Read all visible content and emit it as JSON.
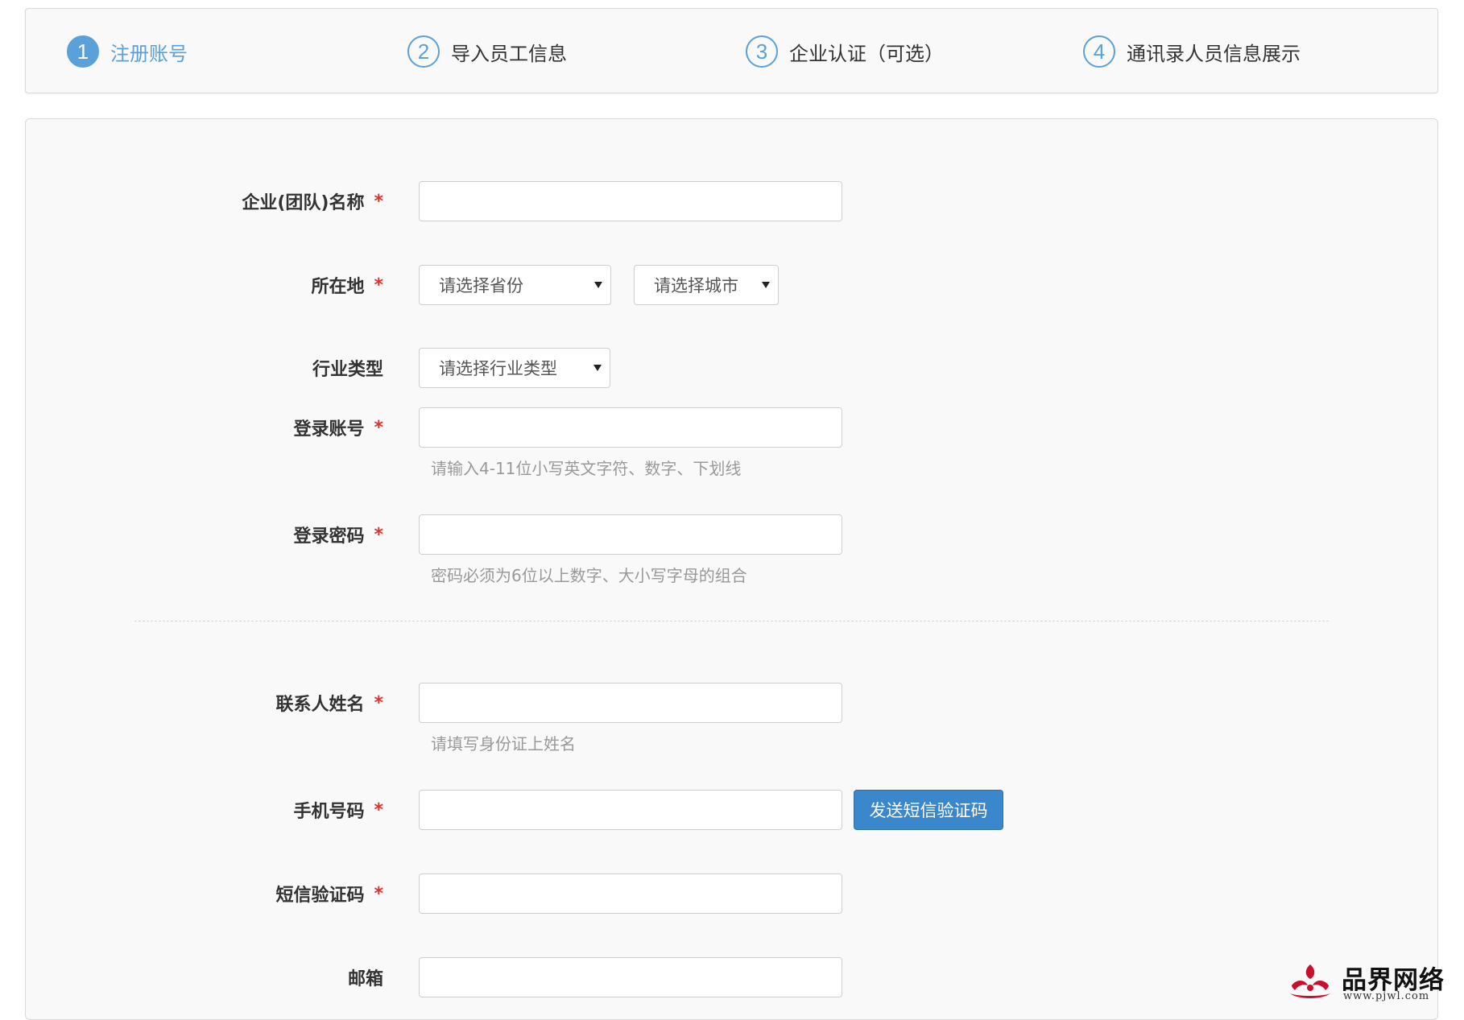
{
  "steps": [
    {
      "num": "1",
      "label": "注册账号",
      "active": true
    },
    {
      "num": "2",
      "label": "导入员工信息",
      "active": false
    },
    {
      "num": "3",
      "label": "企业认证（可选）",
      "active": false
    },
    {
      "num": "4",
      "label": "通讯录人员信息展示",
      "active": false
    }
  ],
  "form": {
    "required_mark": "*",
    "company_name": {
      "label": "企业(团队)名称",
      "value": ""
    },
    "location": {
      "label": "所在地",
      "province_placeholder": "请选择省份",
      "city_placeholder": "请选择城市"
    },
    "industry": {
      "label": "行业类型",
      "placeholder": "请选择行业类型"
    },
    "login_account": {
      "label": "登录账号",
      "value": "",
      "hint": "请输入4-11位小写英文字符、数字、下划线"
    },
    "login_password": {
      "label": "登录密码",
      "value": "",
      "hint": "密码必须为6位以上数字、大小写字母的组合"
    },
    "contact_name": {
      "label": "联系人姓名",
      "value": "",
      "hint": "请填写身份证上姓名"
    },
    "phone": {
      "label": "手机号码",
      "value": "",
      "send_sms_label": "发送短信验证码"
    },
    "sms_code": {
      "label": "短信验证码",
      "value": ""
    },
    "email": {
      "label": "邮箱",
      "value": ""
    }
  },
  "watermark": {
    "text": "品界网络",
    "url": "www.pjwl.com"
  },
  "colors": {
    "accent": "#5aa0d9",
    "button": "#3a87cc",
    "required": "#dd3333"
  }
}
